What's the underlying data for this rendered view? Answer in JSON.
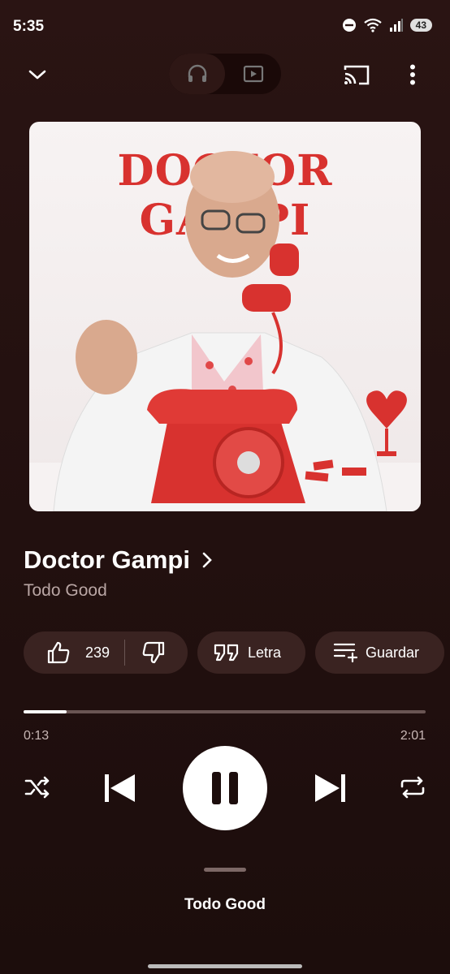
{
  "status_bar": {
    "time": "5:35",
    "battery": "43"
  },
  "top_bar": {
    "collapse_icon": "chevron-down-icon",
    "audio_mode_icon": "headphones-icon",
    "video_mode_icon": "video-icon",
    "cast_icon": "cast-icon",
    "more_icon": "more-vertical-icon"
  },
  "album_art": {
    "title_text": "DOCTOR GAMPI"
  },
  "song": {
    "title": "Doctor Gampi",
    "artist": "Todo Good"
  },
  "actions": {
    "like_count": "239",
    "lyrics_label": "Letra",
    "save_label": "Guardar"
  },
  "progress": {
    "current": "0:13",
    "total": "2:01",
    "fraction": 0.107
  },
  "controls": {
    "shuffle_icon": "shuffle-icon",
    "previous_icon": "skip-previous-icon",
    "pause_icon": "pause-icon",
    "next_icon": "skip-next-icon",
    "repeat_icon": "repeat-icon"
  },
  "up_next": {
    "label": "Todo Good"
  },
  "colors": {
    "background": "#241110",
    "chip": "#3a2321",
    "accent_red": "#d8322f"
  }
}
